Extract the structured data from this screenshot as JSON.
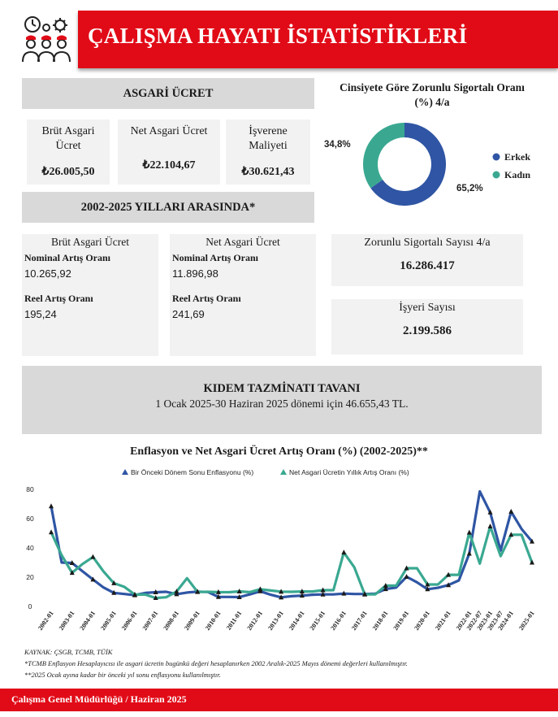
{
  "header": {
    "title": "ÇALIŞMA HAYATI İSTATİSTİKLERİ",
    "logo_icon": "workers-gears-icon"
  },
  "asgari": {
    "title": "ASGARİ ÜCRET",
    "items": [
      {
        "label1": "Brüt Asgari",
        "label2": "Ücret",
        "value": "₺26.005,50"
      },
      {
        "label1": "Net Asgari Ücret",
        "label2": "",
        "value": "₺22.104,67"
      },
      {
        "label1": "İşverene",
        "label2": "Maliyeti",
        "value": "₺30.621,43"
      }
    ]
  },
  "donut": {
    "title1": "Cinsiyete Göre Zorunlu Sigortalı Oranı",
    "title2": "(%) 4/a",
    "slices": [
      {
        "name": "Erkek",
        "value": 65.2,
        "label": "65,2%",
        "color": "#2f55a4"
      },
      {
        "name": "Kadın",
        "value": 34.8,
        "label": "34,8%",
        "color": "#3aa891"
      }
    ]
  },
  "period": {
    "title": "2002-2025 YILLARI ARASINDA*",
    "brut": {
      "title": "Brüt Asgari Ücret",
      "nominal_label": "Nominal Artış Oranı",
      "nominal_value": "10.265,92",
      "reel_label": "Reel Artış Oranı",
      "reel_value": "195,24"
    },
    "net": {
      "title": "Net Asgari Ücret",
      "nominal_label": "Nominal Artış Oranı",
      "nominal_value": "11.896,98",
      "reel_label": "Reel Artış Oranı",
      "reel_value": "241,69"
    }
  },
  "stats": {
    "sigortali_label": "Zorunlu Sigortalı Sayısı 4/a",
    "sigortali_value": "16.286.417",
    "isyeri_label": "İşyeri Sayısı",
    "isyeri_value": "2.199.586"
  },
  "kidem": {
    "title": "KIDEM TAZMİNATI TAVANI",
    "text": "1 Ocak 2025-30 Haziran 2025 dönemi için 46.655,43 TL."
  },
  "chart_data": {
    "type": "line",
    "title": "Enflasyon ve Net Asgari Ücret Artış Oranı (%) (2002-2025)**",
    "x": [
      "2002-01",
      "2002-07",
      "2003-01",
      "2003-07",
      "2004-01",
      "2004-07",
      "2005-01",
      "2005-07",
      "2006-01",
      "2006-07",
      "2007-01",
      "2007-07",
      "2008-01",
      "2008-07",
      "2009-01",
      "2009-07",
      "2010-01",
      "2010-07",
      "2011-01",
      "2011-07",
      "2012-01",
      "2012-07",
      "2013-01",
      "2013-07",
      "2014-01",
      "2014-07",
      "2015-01",
      "2015-07",
      "2016-01",
      "2016-07",
      "2017-01",
      "2017-07",
      "2018-01",
      "2018-07",
      "2019-01",
      "2019-07",
      "2020-01",
      "2020-07",
      "2021-01",
      "2021-07",
      "2022-01",
      "2022-07",
      "2023-01",
      "2023-07",
      "2024-01",
      "2024-07",
      "2025-01"
    ],
    "tick_labels": [
      "2002-01",
      "2003-01",
      "2004-01",
      "2005-01",
      "2006-01",
      "2007-01",
      "2008-01",
      "2009-01",
      "2010-01",
      "2011-01",
      "2012-01",
      "2013-01",
      "2014-01",
      "2015-01",
      "2016-01",
      "2017-01",
      "2018-01",
      "2019-01",
      "2020-01",
      "2021-01",
      "2022-01",
      "2022-07",
      "2023-01",
      "2023-07",
      "2024-01",
      "2025-01"
    ],
    "ylim": [
      0,
      80
    ],
    "yticks": [
      0,
      20,
      40,
      60,
      80
    ],
    "legend": "top",
    "grid": false,
    "series": [
      {
        "name": "Bir Önceki Dönem Sonu Enflasyonu (%)",
        "color": "#2f55a4",
        "marker": "#1a1a1a",
        "values": [
          68.5,
          30,
          29.7,
          24,
          18.4,
          13,
          9.3,
          8.5,
          7.7,
          9.2,
          9.7,
          10,
          8.4,
          9.5,
          10.1,
          9.9,
          6.5,
          6.5,
          6.4,
          8.2,
          10.4,
          8,
          6.2,
          7,
          7.4,
          8,
          8.2,
          8.2,
          8.8,
          8.5,
          8.5,
          8.7,
          11.9,
          12.9,
          20.3,
          16.5,
          11.8,
          12.7,
          14.6,
          17.8,
          36.1,
          78.6,
          64.3,
          38.2,
          64.8,
          53,
          44.4
        ]
      },
      {
        "name": "Net Asgari Ücretin Yıllık Artış Oranı (%)",
        "color": "#3aa891",
        "marker": "#1a1a1a",
        "values": [
          50.7,
          35,
          23,
          29,
          33.8,
          24,
          15.9,
          13.4,
          8.1,
          8.1,
          5.8,
          6.3,
          10.2,
          19.3,
          9.9,
          10,
          9.8,
          9.7,
          10.3,
          9.8,
          11.8,
          10.9,
          10.1,
          10,
          10.2,
          10.2,
          11.1,
          11.1,
          36.9,
          26.8,
          8.2,
          8.2,
          14.2,
          14.2,
          26.1,
          26.1,
          15,
          15,
          21.6,
          21.6,
          50.5,
          29.3,
          54.7,
          34.4,
          49,
          49,
          30
        ]
      }
    ]
  },
  "notes": {
    "source": "KAYNAK: ÇSGB, TCMB, TÜİK",
    "note1": "*TCMB Enflasyon Hesaplayıcısı ile asgari ücretin bugünkü değeri hesaplanırken 2002 Aralık-2025 Mayıs dönemi değerleri  kullanılmıştır.",
    "note2": "**2025 Ocak ayına kadar bir önceki yıl sonu enflasyonu kullanılmıştır."
  },
  "footer": {
    "text": "Çalışma Genel Müdürlüğü / Haziran 2025"
  }
}
